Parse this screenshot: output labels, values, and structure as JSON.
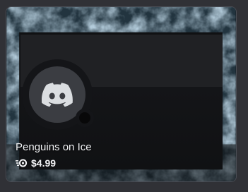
{
  "item": {
    "title": "Penguins on Ice",
    "price": "$4.99"
  },
  "icons": {
    "avatar": "discord-logo-icon",
    "price": "nitro-icon"
  },
  "colors": {
    "frame_ice": "#8fb6cf",
    "frame_dark": "#1a2a36",
    "avatar_bg": "#3b3d42",
    "text": "#f2f3f5"
  }
}
